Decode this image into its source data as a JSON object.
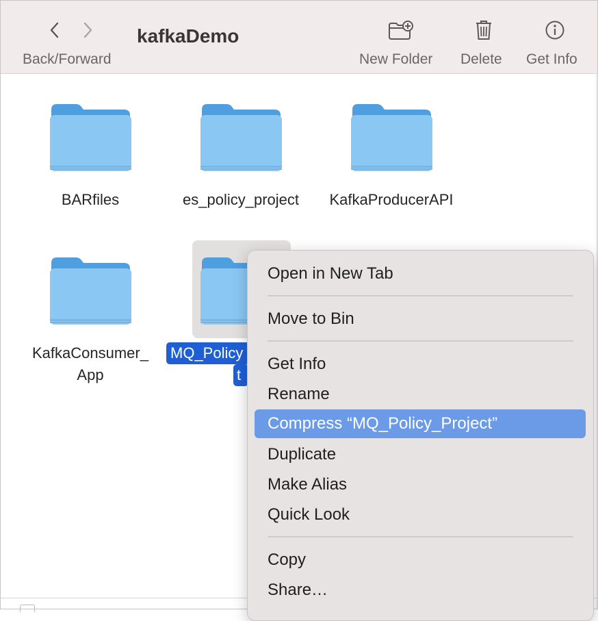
{
  "toolbar": {
    "title": "kafkaDemo",
    "back_forward_label": "Back/Forward",
    "new_folder_label": "New Folder",
    "delete_label": "Delete",
    "get_info_label": "Get Info"
  },
  "folders": [
    {
      "label": "BARfiles"
    },
    {
      "label": "es_policy_project"
    },
    {
      "label": "KafkaProducerAPI"
    },
    {
      "label_line1": "KafkaConsumer_",
      "label_line2": "App"
    },
    {
      "label_line1": "MQ_Policy",
      "label_line2": "t",
      "selected": true
    }
  ],
  "context_menu": {
    "items": [
      {
        "label": "Open in New Tab"
      },
      {
        "label": "Move to Bin"
      },
      {
        "label": "Get Info"
      },
      {
        "label": "Rename"
      },
      {
        "label": "Compress “MQ_Policy_Project”",
        "highlighted": true
      },
      {
        "label": "Duplicate"
      },
      {
        "label": "Make Alias"
      },
      {
        "label": "Quick Look"
      },
      {
        "label": "Copy"
      },
      {
        "label": "Share…"
      }
    ]
  },
  "colors": {
    "folder_body": "#8ac7f2",
    "folder_tab": "#4f9ee0",
    "selection": "#1f5fd6",
    "menu_highlight": "#6b9be6"
  }
}
